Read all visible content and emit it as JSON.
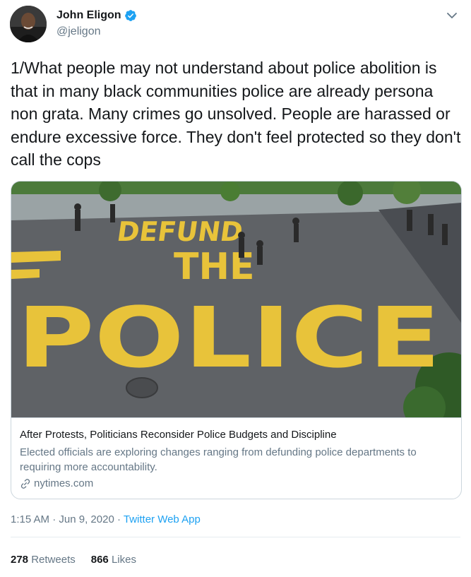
{
  "author": {
    "name": "John Eligon",
    "handle": "@jeligon"
  },
  "tweet": {
    "text": "1/What people may not understand about police abolition is that in many black communities police are already persona non grata. Many crimes go unsolved. People are harassed or endure excessive force. They don't feel protected so they don't call the cops"
  },
  "card": {
    "image_words": [
      "DEFUND",
      "THE",
      "POLICE"
    ],
    "title": "After Protests, Politicians Reconsider Police Budgets and Discipline",
    "description": "Elected officials are exploring changes ranging from defunding police departments to requiring more accountability.",
    "domain": "nytimes.com"
  },
  "meta": {
    "time": "1:15 AM",
    "sep1": " · ",
    "date": "Jun 9, 2020",
    "sep2": " · ",
    "app": "Twitter Web App"
  },
  "stats": {
    "retweets_count": "278",
    "retweets_label": "Retweets",
    "likes_count": "866",
    "likes_label": "Likes"
  },
  "colors": {
    "accent": "#1da1f2",
    "secondary_text": "#657786",
    "road_paint": "#e8c33a"
  },
  "icons": {
    "verified": "verified-badge-icon",
    "caret": "chevron-down-icon",
    "link": "link-icon"
  }
}
